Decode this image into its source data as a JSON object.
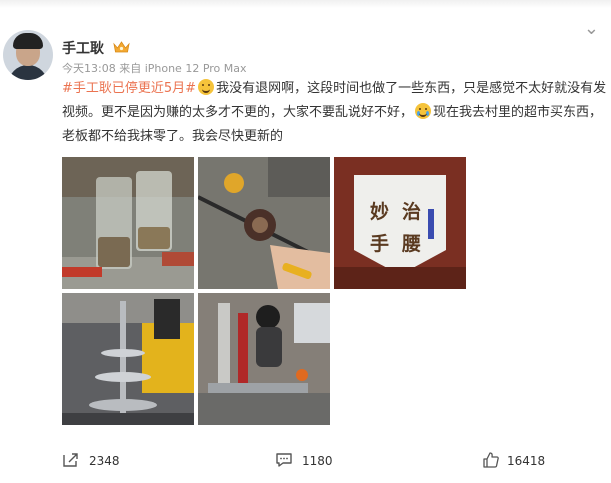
{
  "post": {
    "username": "手工耿",
    "meta": "今天13:08  来自 iPhone 12 Pro Max",
    "hashtag": "#手工耿已停更近5月#",
    "text_part1": "我没有退网啊，这段时间也做了一些东西，只是感觉不太好就没有发视频。更不是因为赚的太多才不更的，大家不要乱说好不好，",
    "text_part2": "现在我去村里的超市买东西，老板都不给我抹零了。我会尽快更新的",
    "banner_chars": [
      "妙",
      "治",
      "手",
      "腰"
    ]
  },
  "actions": {
    "repost_count": "2348",
    "comment_count": "1180",
    "like_count": "16418"
  },
  "colors": {
    "hashtag": "#eb7350",
    "text": "#333333",
    "meta": "#999999"
  },
  "icons": {
    "repost": "share-arrow-icon",
    "comment": "comment-bubble-icon",
    "like": "thumbs-up-icon",
    "more": "more-dots-icon",
    "badge": "crown-badge-icon"
  }
}
